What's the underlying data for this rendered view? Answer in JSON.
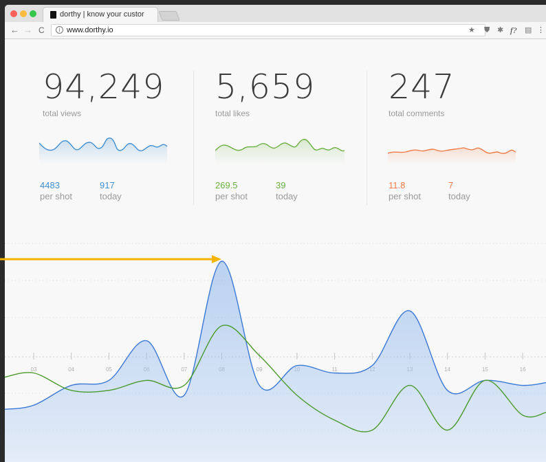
{
  "browser": {
    "tab_title": "dorthy | know your custor",
    "url": "www.dorthy.io",
    "nav": {
      "back": "←",
      "forward": "→",
      "reload": "C"
    },
    "toolbar_icons": [
      "★",
      "⛊",
      "✱",
      "f?",
      "▤",
      "⋮"
    ]
  },
  "stats": [
    {
      "value": "94,249",
      "label": "total views",
      "per_shot": "4483",
      "per_shot_label": "per shot",
      "today": "917",
      "today_label": "today",
      "color": "#3f8fd2"
    },
    {
      "value": "5,659",
      "label": "total likes",
      "per_shot": "269.5",
      "per_shot_label": "per shot",
      "today": "39",
      "today_label": "today",
      "color": "#6ab03e"
    },
    {
      "value": "247",
      "label": "total comments",
      "per_shot": "11.8",
      "per_shot_label": "per shot",
      "today": "7",
      "today_label": "today",
      "color": "#f07a45"
    }
  ],
  "chart": {
    "x_labels": [
      "03",
      "04",
      "05",
      "06",
      "07",
      "08",
      "09",
      "10",
      "11",
      "12",
      "13",
      "14",
      "15",
      "16"
    ],
    "blue_color": "#3a78d6",
    "green_color": "#4a9a2e",
    "arrow_color": "#f5b400",
    "blue_series": [
      0.14,
      0.22,
      0.24,
      0.4,
      0.18,
      0.72,
      0.22,
      0.3,
      0.27,
      0.3,
      0.52,
      0.2,
      0.24,
      0.22
    ],
    "green_series": [
      0.27,
      0.2,
      0.2,
      0.24,
      0.22,
      0.46,
      0.34,
      0.18,
      0.08,
      0.04,
      0.22,
      0.04,
      0.24,
      0.1
    ]
  }
}
